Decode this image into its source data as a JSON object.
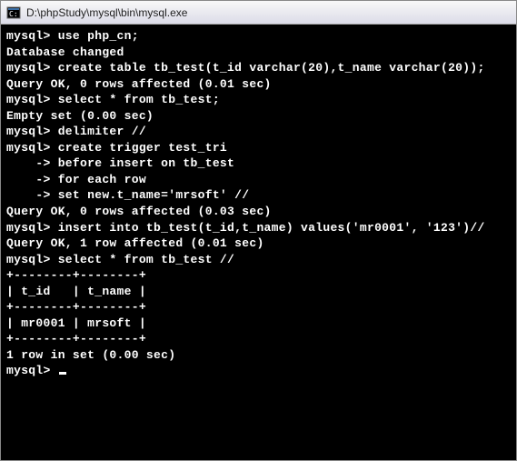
{
  "titlebar": {
    "path": "D:\\phpStudy\\mysql\\bin\\mysql.exe"
  },
  "terminal": {
    "lines": [
      "",
      "mysql> use php_cn;",
      "Database changed",
      "mysql> create table tb_test(t_id varchar(20),t_name varchar(20));",
      "Query OK, 0 rows affected (0.01 sec)",
      "",
      "mysql> select * from tb_test;",
      "Empty set (0.00 sec)",
      "",
      "mysql> delimiter //",
      "mysql> create trigger test_tri",
      "    -> before insert on tb_test",
      "    -> for each row",
      "    -> set new.t_name='mrsoft' //",
      "Query OK, 0 rows affected (0.03 sec)",
      "",
      "mysql> insert into tb_test(t_id,t_name) values('mr0001', '123')//",
      "Query OK, 1 row affected (0.01 sec)",
      "",
      "mysql> select * from tb_test //",
      "+--------+--------+",
      "| t_id   | t_name |",
      "+--------+--------+",
      "| mr0001 | mrsoft |",
      "+--------+--------+",
      "1 row in set (0.00 sec)",
      "",
      "mysql> "
    ]
  }
}
